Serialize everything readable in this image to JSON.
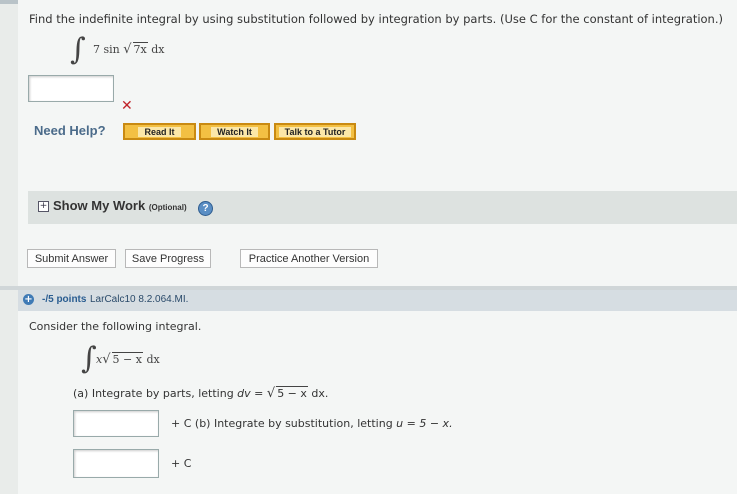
{
  "q1": {
    "prompt": "Find the indefinite integral by using substitution followed by integration by parts. (Use C for the constant of integration.)",
    "integral_sign": "∫",
    "coef": "7 sin",
    "radicand": "7x",
    "dx": "dx",
    "answer_value": "",
    "wrong_mark": "✕"
  },
  "help": {
    "label": "Need Help?",
    "read_it": "Read It",
    "watch_it": "Watch It",
    "talk_tutor": "Talk to a Tutor"
  },
  "show_work": {
    "plus": "+",
    "label": "Show My Work",
    "optional": "(Optional)",
    "help": "?"
  },
  "actions": {
    "submit": "Submit Answer",
    "save": "Save Progress",
    "practice": "Practice Another Version"
  },
  "q2": {
    "icon": "+",
    "points": "-/5 points",
    "code": "LarCalc10 8.2.064.MI.",
    "intro": "Consider the following integral.",
    "integral_sign": "∫",
    "x": "x",
    "radicand": "5 − x",
    "dx": "dx",
    "part_a_prefix": "(a) Integrate by parts, letting",
    "part_a_dv": "dv =",
    "part_a_radicand": "5 − x",
    "part_a_suffix": "dx.",
    "plus_c_a": "+ C",
    "part_b": "(b) Integrate by substitution, letting",
    "part_b_u": "u = 5 − x.",
    "plus_c_b": "+ C",
    "answer_a": "",
    "answer_b": ""
  }
}
